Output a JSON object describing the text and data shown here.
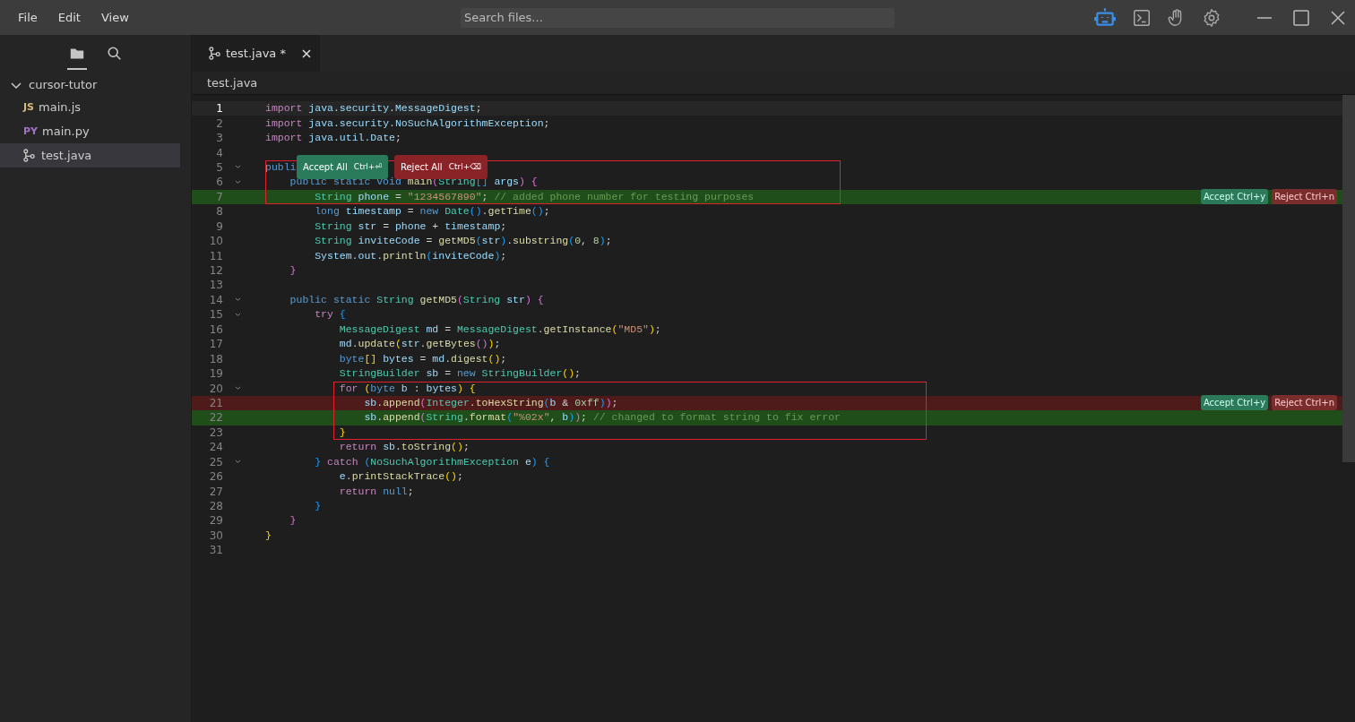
{
  "menu": [
    "File",
    "Edit",
    "View"
  ],
  "search": {
    "placeholder": "Search files..."
  },
  "toolbar": [
    {
      "kind": "robot",
      "active": true
    },
    {
      "kind": "terminal",
      "active": false
    },
    {
      "kind": "hand",
      "active": false
    },
    {
      "kind": "settings",
      "active": false
    }
  ],
  "sidebar": {
    "views": [
      {
        "kind": "files",
        "selected": true
      },
      {
        "kind": "search",
        "selected": false
      }
    ],
    "tree": {
      "label": "cursor-tutor",
      "expanded": true,
      "children": [
        {
          "label": "main.js",
          "badge": "JS",
          "kind": "js",
          "selected": false
        },
        {
          "label": "main.py",
          "badge": "PY",
          "kind": "py",
          "selected": false
        },
        {
          "label": "test.java",
          "kind": "java",
          "selected": true
        }
      ]
    }
  },
  "tabs": [
    {
      "label": "test.java *",
      "selected": true
    }
  ],
  "breadcrumb": "test.java",
  "lines": [
    {
      "number": "1",
      "current": true,
      "fold": false,
      "kind": "plain",
      "annotated": false,
      "tokens": [
        {
          "kind": "keyword",
          "text": "import"
        },
        {
          "kind": "variable",
          "text": " java.security.MessageDigest"
        },
        {
          "kind": "punct",
          "text": ";"
        }
      ]
    },
    {
      "number": "2",
      "current": false,
      "fold": false,
      "kind": "plain",
      "annotated": false,
      "tokens": [
        {
          "kind": "keyword",
          "text": "import"
        },
        {
          "kind": "variable",
          "text": " java.security.NoSuchAlgorithmException"
        },
        {
          "kind": "punct",
          "text": ";"
        }
      ]
    },
    {
      "number": "3",
      "current": false,
      "fold": false,
      "kind": "plain",
      "annotated": false,
      "tokens": [
        {
          "kind": "keyword",
          "text": "import"
        },
        {
          "kind": "variable",
          "text": " java.util.Date"
        },
        {
          "kind": "punct",
          "text": ";"
        }
      ]
    },
    {
      "number": "4",
      "current": false,
      "fold": false,
      "kind": "plain",
      "annotated": false
    },
    {
      "number": "5",
      "current": false,
      "fold": true,
      "kind": "plain",
      "annotated": true,
      "tokens": [
        {
          "kind": "storage",
          "text": "publi"
        }
      ],
      "review_bar": {
        "accept": "Accept All",
        "accept_shortcut": "Ctrl+⏎",
        "reject": "Reject All",
        "reject_shortcut": "Ctrl+⌫"
      }
    },
    {
      "number": "6",
      "current": false,
      "fold": true,
      "kind": "plain",
      "annotated": true,
      "tokens": [
        {
          "kind": "storage",
          "text": "    public static void"
        },
        {
          "kind": "function",
          "text": " main"
        },
        {
          "kind": "bracket2",
          "text": "("
        },
        {
          "kind": "type",
          "text": "String"
        },
        {
          "kind": "bracket3",
          "text": "[]"
        },
        {
          "kind": "variable",
          "text": " args"
        },
        {
          "kind": "bracket2",
          "text": ")"
        },
        {
          "kind": "bracket2",
          "text": " {"
        }
      ]
    },
    {
      "number": "7",
      "current": false,
      "fold": false,
      "kind": "added",
      "annotated": true,
      "tokens": [
        {
          "kind": "type",
          "text": "        String"
        },
        {
          "kind": "variable",
          "text": " phone"
        },
        {
          "kind": "punct",
          "text": " ="
        },
        {
          "kind": "string",
          "text": " \"1234567890\""
        },
        {
          "kind": "punct",
          "text": ";"
        },
        {
          "kind": "comment",
          "text": " // added phone number for testing purposes"
        }
      ],
      "actions": [
        {
          "kind": "accept",
          "label": "Accept Ctrl+y"
        },
        {
          "kind": "reject",
          "label": "Reject Ctrl+n"
        }
      ]
    },
    {
      "number": "8",
      "current": false,
      "fold": false,
      "kind": "plain",
      "annotated": false,
      "tokens": [
        {
          "kind": "storage",
          "text": "        long"
        },
        {
          "kind": "variable",
          "text": " timestamp"
        },
        {
          "kind": "punct",
          "text": " ="
        },
        {
          "kind": "storage",
          "text": " new"
        },
        {
          "kind": "type",
          "text": " Date"
        },
        {
          "kind": "bracket3",
          "text": "()"
        },
        {
          "kind": "punct",
          "text": "."
        },
        {
          "kind": "function",
          "text": "getTime"
        },
        {
          "kind": "bracket3",
          "text": "()"
        },
        {
          "kind": "punct",
          "text": ";"
        }
      ]
    },
    {
      "number": "9",
      "current": false,
      "fold": false,
      "kind": "plain",
      "annotated": false,
      "tokens": [
        {
          "kind": "type",
          "text": "        String"
        },
        {
          "kind": "variable",
          "text": " str"
        },
        {
          "kind": "punct",
          "text": " ="
        },
        {
          "kind": "variable",
          "text": " phone"
        },
        {
          "kind": "punct",
          "text": " +"
        },
        {
          "kind": "variable",
          "text": " timestamp"
        },
        {
          "kind": "punct",
          "text": ";"
        }
      ]
    },
    {
      "number": "10",
      "current": false,
      "fold": false,
      "kind": "plain",
      "annotated": false,
      "tokens": [
        {
          "kind": "type",
          "text": "        String"
        },
        {
          "kind": "variable",
          "text": " inviteCode"
        },
        {
          "kind": "punct",
          "text": " ="
        },
        {
          "kind": "function",
          "text": " getMD5"
        },
        {
          "kind": "bracket3",
          "text": "("
        },
        {
          "kind": "variable",
          "text": "str"
        },
        {
          "kind": "bracket3",
          "text": ")"
        },
        {
          "kind": "punct",
          "text": "."
        },
        {
          "kind": "function",
          "text": "substring"
        },
        {
          "kind": "bracket3",
          "text": "("
        },
        {
          "kind": "number",
          "text": "0"
        },
        {
          "kind": "punct",
          "text": ","
        },
        {
          "kind": "number",
          "text": " 8"
        },
        {
          "kind": "bracket3",
          "text": ")"
        },
        {
          "kind": "punct",
          "text": ";"
        }
      ]
    },
    {
      "number": "11",
      "current": false,
      "fold": false,
      "kind": "plain",
      "annotated": false,
      "tokens": [
        {
          "kind": "variable",
          "text": "        System.out"
        },
        {
          "kind": "punct",
          "text": "."
        },
        {
          "kind": "function",
          "text": "println"
        },
        {
          "kind": "bracket3",
          "text": "("
        },
        {
          "kind": "variable",
          "text": "inviteCode"
        },
        {
          "kind": "bracket3",
          "text": ")"
        },
        {
          "kind": "punct",
          "text": ";"
        }
      ]
    },
    {
      "number": "12",
      "current": false,
      "fold": false,
      "kind": "plain",
      "annotated": false,
      "tokens": [
        {
          "kind": "bracket2",
          "text": "    }"
        }
      ]
    },
    {
      "number": "13",
      "current": false,
      "fold": false,
      "kind": "plain",
      "annotated": false
    },
    {
      "number": "14",
      "current": false,
      "fold": true,
      "kind": "plain",
      "annotated": false,
      "tokens": [
        {
          "kind": "storage",
          "text": "    public static"
        },
        {
          "kind": "type",
          "text": " String"
        },
        {
          "kind": "function",
          "text": " getMD5"
        },
        {
          "kind": "bracket2",
          "text": "("
        },
        {
          "kind": "type",
          "text": "String"
        },
        {
          "kind": "variable",
          "text": " str"
        },
        {
          "kind": "bracket2",
          "text": ")"
        },
        {
          "kind": "bracket2",
          "text": " {"
        }
      ]
    },
    {
      "number": "15",
      "current": false,
      "fold": true,
      "kind": "plain",
      "annotated": false,
      "tokens": [
        {
          "kind": "keyword",
          "text": "        try"
        },
        {
          "kind": "bracket3",
          "text": " {"
        }
      ]
    },
    {
      "number": "16",
      "current": false,
      "fold": false,
      "kind": "plain",
      "annotated": false,
      "tokens": [
        {
          "kind": "type",
          "text": "            MessageDigest"
        },
        {
          "kind": "variable",
          "text": " md"
        },
        {
          "kind": "punct",
          "text": " ="
        },
        {
          "kind": "type",
          "text": " MessageDigest"
        },
        {
          "kind": "punct",
          "text": "."
        },
        {
          "kind": "function",
          "text": "getInstance"
        },
        {
          "kind": "bracket1",
          "text": "("
        },
        {
          "kind": "string",
          "text": "\"MD5\""
        },
        {
          "kind": "bracket1",
          "text": ")"
        },
        {
          "kind": "punct",
          "text": ";"
        }
      ]
    },
    {
      "number": "17",
      "current": false,
      "fold": false,
      "kind": "plain",
      "annotated": false,
      "tokens": [
        {
          "kind": "variable",
          "text": "            md"
        },
        {
          "kind": "punct",
          "text": "."
        },
        {
          "kind": "function",
          "text": "update"
        },
        {
          "kind": "bracket1",
          "text": "("
        },
        {
          "kind": "variable",
          "text": "str"
        },
        {
          "kind": "punct",
          "text": "."
        },
        {
          "kind": "function",
          "text": "getBytes"
        },
        {
          "kind": "bracket2",
          "text": "()"
        },
        {
          "kind": "bracket1",
          "text": ")"
        },
        {
          "kind": "punct",
          "text": ";"
        }
      ]
    },
    {
      "number": "18",
      "current": false,
      "fold": false,
      "kind": "plain",
      "annotated": false,
      "tokens": [
        {
          "kind": "storage",
          "text": "            byte"
        },
        {
          "kind": "bracket1",
          "text": "[]"
        },
        {
          "kind": "variable",
          "text": " bytes"
        },
        {
          "kind": "punct",
          "text": " ="
        },
        {
          "kind": "variable",
          "text": " md"
        },
        {
          "kind": "punct",
          "text": "."
        },
        {
          "kind": "function",
          "text": "digest"
        },
        {
          "kind": "bracket1",
          "text": "()"
        },
        {
          "kind": "punct",
          "text": ";"
        }
      ]
    },
    {
      "number": "19",
      "current": false,
      "fold": false,
      "kind": "plain",
      "annotated": false,
      "tokens": [
        {
          "kind": "type",
          "text": "            StringBuilder"
        },
        {
          "kind": "variable",
          "text": " sb"
        },
        {
          "kind": "punct",
          "text": " ="
        },
        {
          "kind": "storage",
          "text": " new"
        },
        {
          "kind": "type",
          "text": " StringBuilder"
        },
        {
          "kind": "bracket1",
          "text": "()"
        },
        {
          "kind": "punct",
          "text": ";"
        }
      ]
    },
    {
      "number": "20",
      "current": false,
      "fold": true,
      "kind": "plain",
      "annotated": true,
      "tokens": [
        {
          "kind": "keyword",
          "text": "            for"
        },
        {
          "kind": "bracket1",
          "text": " ("
        },
        {
          "kind": "storage",
          "text": "byte"
        },
        {
          "kind": "variable",
          "text": " b"
        },
        {
          "kind": "punct",
          "text": " :"
        },
        {
          "kind": "variable",
          "text": " bytes"
        },
        {
          "kind": "bracket1",
          "text": ")"
        },
        {
          "kind": "bracket1",
          "text": " {"
        }
      ]
    },
    {
      "number": "21",
      "current": false,
      "fold": false,
      "kind": "removed",
      "annotated": true,
      "tokens": [
        {
          "kind": "variable",
          "text": "                sb"
        },
        {
          "kind": "punct",
          "text": "."
        },
        {
          "kind": "function",
          "text": "append"
        },
        {
          "kind": "bracket2",
          "text": "("
        },
        {
          "kind": "type",
          "text": "Integer"
        },
        {
          "kind": "punct",
          "text": "."
        },
        {
          "kind": "function",
          "text": "toHexString"
        },
        {
          "kind": "bracket3",
          "text": "("
        },
        {
          "kind": "variable",
          "text": "b"
        },
        {
          "kind": "punct",
          "text": " &"
        },
        {
          "kind": "number",
          "text": " 0xff"
        },
        {
          "kind": "bracket3",
          "text": ")"
        },
        {
          "kind": "bracket2",
          "text": ")"
        },
        {
          "kind": "punct",
          "text": ";"
        }
      ],
      "actions": [
        {
          "kind": "accept",
          "label": "Accept Ctrl+y"
        },
        {
          "kind": "reject",
          "label": "Reject Ctrl+n"
        }
      ]
    },
    {
      "number": "22",
      "current": false,
      "fold": false,
      "kind": "added",
      "annotated": true,
      "tokens": [
        {
          "kind": "variable",
          "text": "                sb"
        },
        {
          "kind": "punct",
          "text": "."
        },
        {
          "kind": "function",
          "text": "append"
        },
        {
          "kind": "bracket2",
          "text": "("
        },
        {
          "kind": "type",
          "text": "String"
        },
        {
          "kind": "punct",
          "text": "."
        },
        {
          "kind": "function",
          "text": "format"
        },
        {
          "kind": "bracket3",
          "text": "("
        },
        {
          "kind": "string",
          "text": "\"%02x\""
        },
        {
          "kind": "punct",
          "text": ","
        },
        {
          "kind": "variable",
          "text": " b"
        },
        {
          "kind": "bracket3",
          "text": ")"
        },
        {
          "kind": "bracket2",
          "text": ")"
        },
        {
          "kind": "punct",
          "text": ";"
        },
        {
          "kind": "comment",
          "text": " // changed to format string to fix error"
        }
      ]
    },
    {
      "number": "23",
      "current": false,
      "fold": false,
      "kind": "plain",
      "annotated": true,
      "tokens": [
        {
          "kind": "bracket1",
          "text": "            }"
        }
      ]
    },
    {
      "number": "24",
      "current": false,
      "fold": false,
      "kind": "plain",
      "annotated": false,
      "tokens": [
        {
          "kind": "keyword",
          "text": "            return"
        },
        {
          "kind": "variable",
          "text": " sb"
        },
        {
          "kind": "punct",
          "text": "."
        },
        {
          "kind": "function",
          "text": "toString"
        },
        {
          "kind": "bracket1",
          "text": "()"
        },
        {
          "kind": "punct",
          "text": ";"
        }
      ]
    },
    {
      "number": "25",
      "current": false,
      "fold": true,
      "kind": "plain",
      "annotated": false,
      "tokens": [
        {
          "kind": "bracket3",
          "text": "        }"
        },
        {
          "kind": "keyword",
          "text": " catch"
        },
        {
          "kind": "bracket3",
          "text": " ("
        },
        {
          "kind": "type",
          "text": "NoSuchAlgorithmException"
        },
        {
          "kind": "variable",
          "text": " e"
        },
        {
          "kind": "bracket3",
          "text": ")"
        },
        {
          "kind": "bracket3",
          "text": " {"
        }
      ]
    },
    {
      "number": "26",
      "current": false,
      "fold": false,
      "kind": "plain",
      "annotated": false,
      "tokens": [
        {
          "kind": "variable",
          "text": "            e"
        },
        {
          "kind": "punct",
          "text": "."
        },
        {
          "kind": "function",
          "text": "printStackTrace"
        },
        {
          "kind": "bracket1",
          "text": "()"
        },
        {
          "kind": "punct",
          "text": ";"
        }
      ]
    },
    {
      "number": "27",
      "current": false,
      "fold": false,
      "kind": "plain",
      "annotated": false,
      "tokens": [
        {
          "kind": "keyword",
          "text": "            return"
        },
        {
          "kind": "storage",
          "text": " null"
        },
        {
          "kind": "punct",
          "text": ";"
        }
      ]
    },
    {
      "number": "28",
      "current": false,
      "fold": false,
      "kind": "plain",
      "annotated": false,
      "tokens": [
        {
          "kind": "bracket3",
          "text": "        }"
        }
      ]
    },
    {
      "number": "29",
      "current": false,
      "fold": false,
      "kind": "plain",
      "annotated": false,
      "tokens": [
        {
          "kind": "bracket2",
          "text": "    }"
        }
      ]
    },
    {
      "number": "30",
      "current": false,
      "fold": false,
      "kind": "plain",
      "annotated": false,
      "tokens": [
        {
          "kind": "bracket1",
          "text": "}"
        }
      ]
    },
    {
      "number": "31",
      "current": false,
      "fold": false,
      "kind": "plain",
      "annotated": false
    }
  ]
}
